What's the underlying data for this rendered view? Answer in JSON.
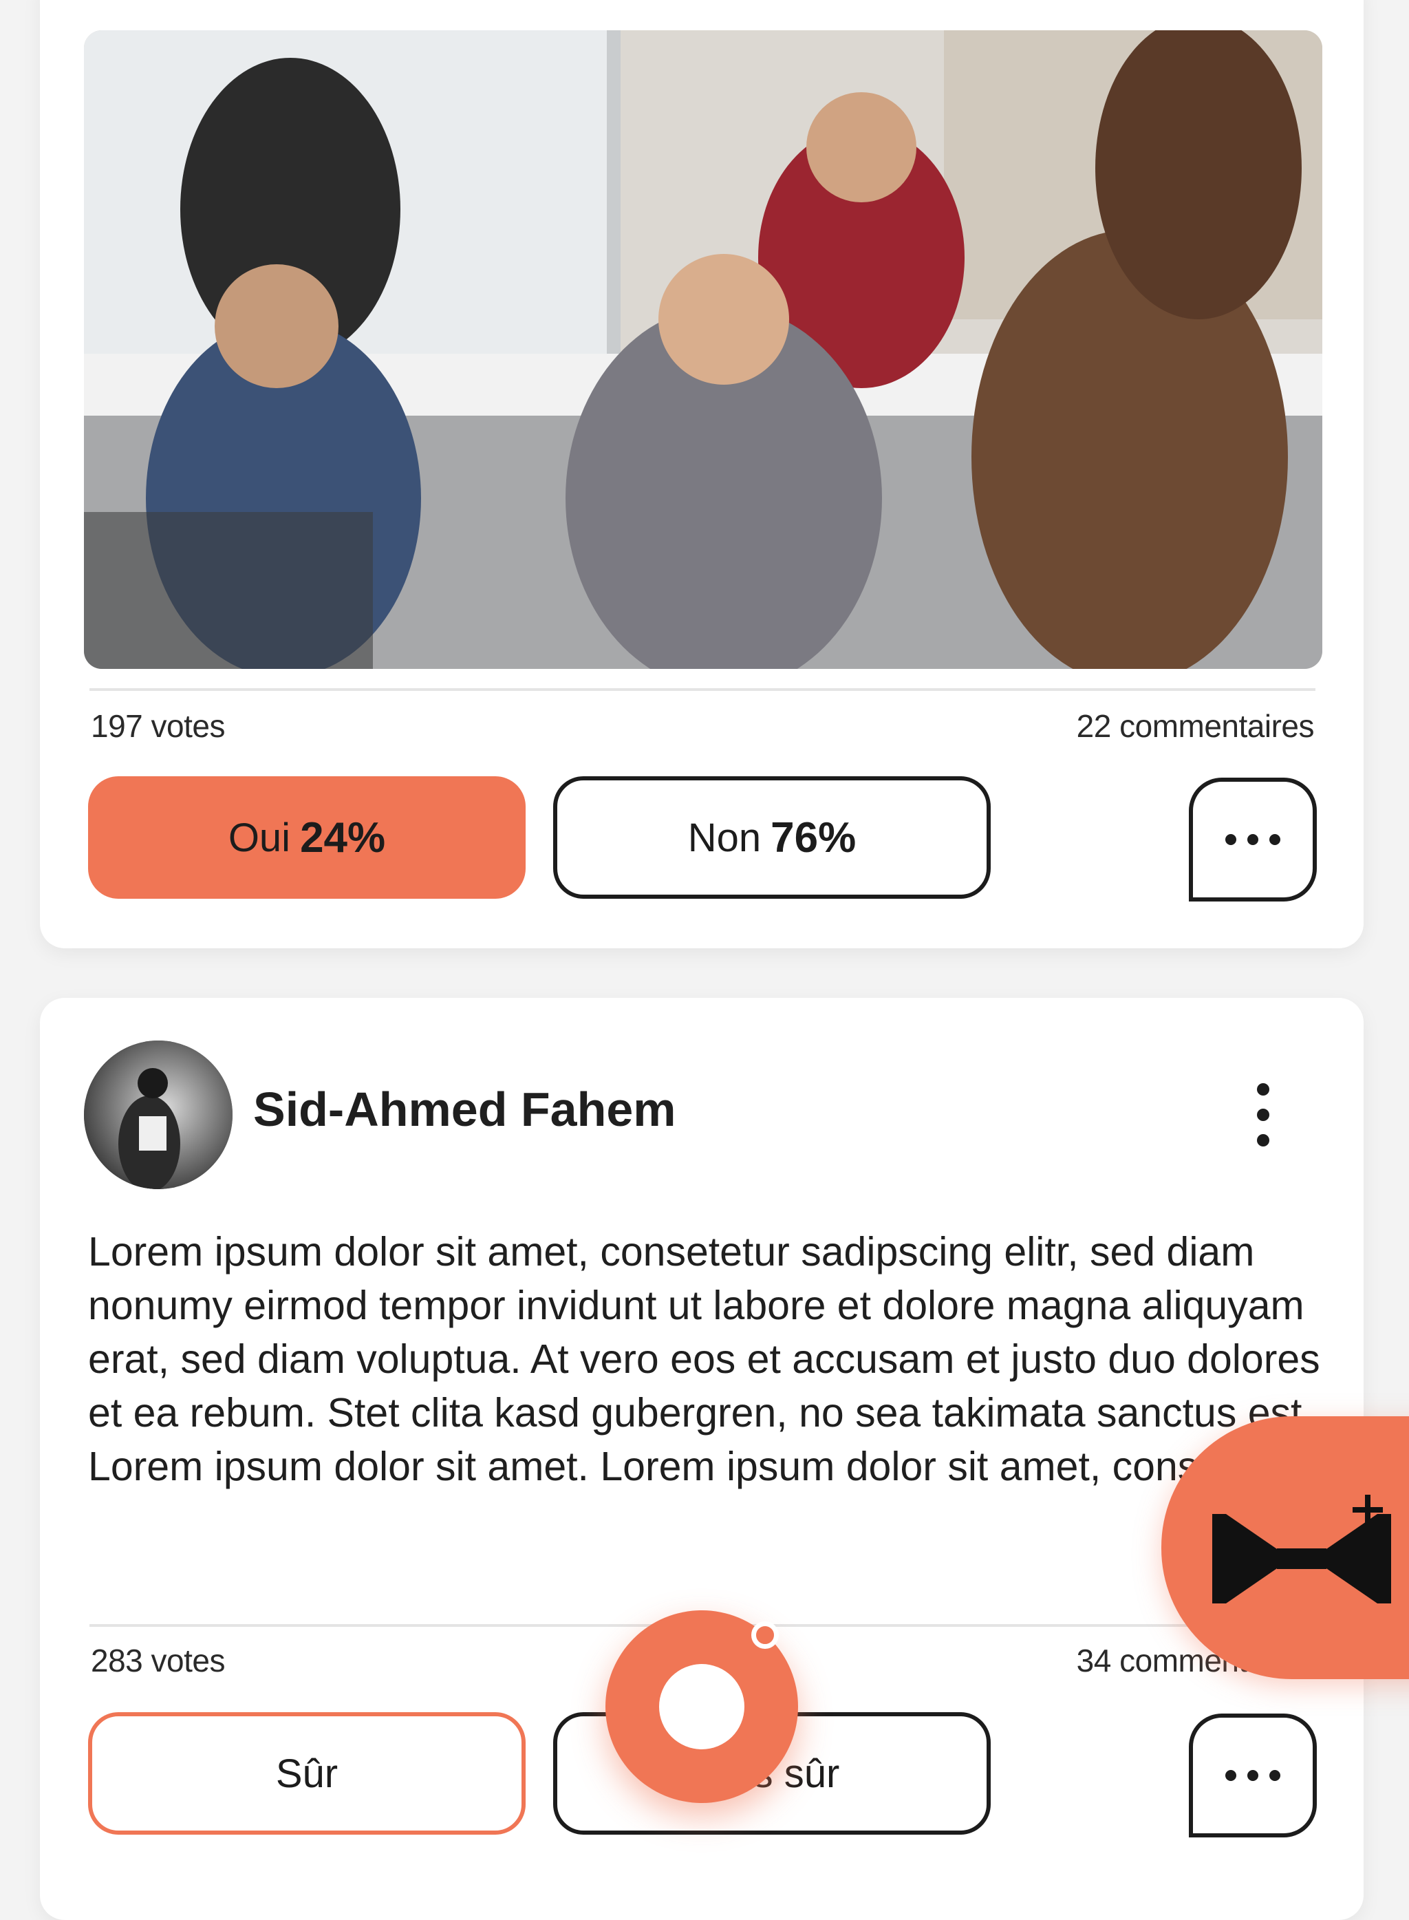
{
  "colors": {
    "accent": "#f07655",
    "card": "#ffffff",
    "background": "#f3f3f3"
  },
  "posts": [
    {
      "image": "group-meeting-photo",
      "votes": "197 votes",
      "comments": "22 commentaires",
      "options": [
        {
          "label": "Oui",
          "percent": "24%",
          "selected": true
        },
        {
          "label": "Non",
          "percent": "76%",
          "selected": false
        }
      ],
      "comment_icon": "speech-bubble-dots-icon"
    },
    {
      "author": "Sid-Ahmed Fahem",
      "text": "Lorem ipsum dolor sit amet, consetetur sadipscing elitr, sed diam nonumy eirmod tempor invidunt ut labore et dolore magna aliquyam erat, sed diam voluptua. At vero eos et accusam et justo duo dolores et ea rebum. Stet clita kasd gubergren, no sea takimata sanctus est Lorem ipsum dolor sit amet. Lorem ipsum dolor sit amet, consetetur.",
      "votes": "283 votes",
      "comments": "34 commentaires",
      "options": [
        {
          "label": "Sûr"
        },
        {
          "label": "Pas sûr"
        }
      ],
      "comment_icon": "speech-bubble-dots-icon"
    }
  ],
  "fab": {
    "new_poll_icon": "megaphone-plus-icon",
    "center_icon": "ring-notification-icon"
  }
}
